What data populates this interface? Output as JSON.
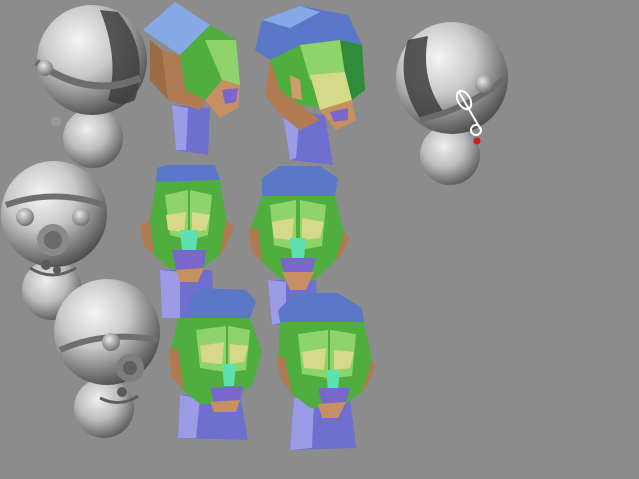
{
  "viewport": {
    "background": "#8c8c8c"
  },
  "colors": {
    "sphere_light": "#f2f2f2",
    "sphere_mid": "#bdbdbd",
    "sphere_dark": "#4a4a4a",
    "face_green": "#4fae3e",
    "face_green_light": "#8fd46a",
    "face_yellow": "#d6d98a",
    "face_tan": "#b07a52",
    "hair_blue": "#5b78c8",
    "hair_light_blue": "#86a9e6",
    "neck_purple": "#6f6fd0",
    "neck_purple_light": "#9c9ce6",
    "joint_red": "#c81e1e"
  },
  "objects": [
    {
      "name": "sphere-head-rig-1",
      "kind": "sphere-rig"
    },
    {
      "name": "sphere-head-rig-2",
      "kind": "sphere-rig"
    },
    {
      "name": "sphere-head-rig-3",
      "kind": "sphere-rig"
    },
    {
      "name": "sphere-head-rig-4",
      "kind": "sphere-rig"
    },
    {
      "name": "lowpoly-head-1",
      "kind": "lowpoly-head"
    },
    {
      "name": "lowpoly-head-2",
      "kind": "lowpoly-head"
    },
    {
      "name": "lowpoly-head-3",
      "kind": "lowpoly-head"
    },
    {
      "name": "lowpoly-head-4",
      "kind": "lowpoly-head"
    },
    {
      "name": "lowpoly-head-5",
      "kind": "lowpoly-head"
    },
    {
      "name": "lowpoly-head-6",
      "kind": "lowpoly-head"
    }
  ]
}
